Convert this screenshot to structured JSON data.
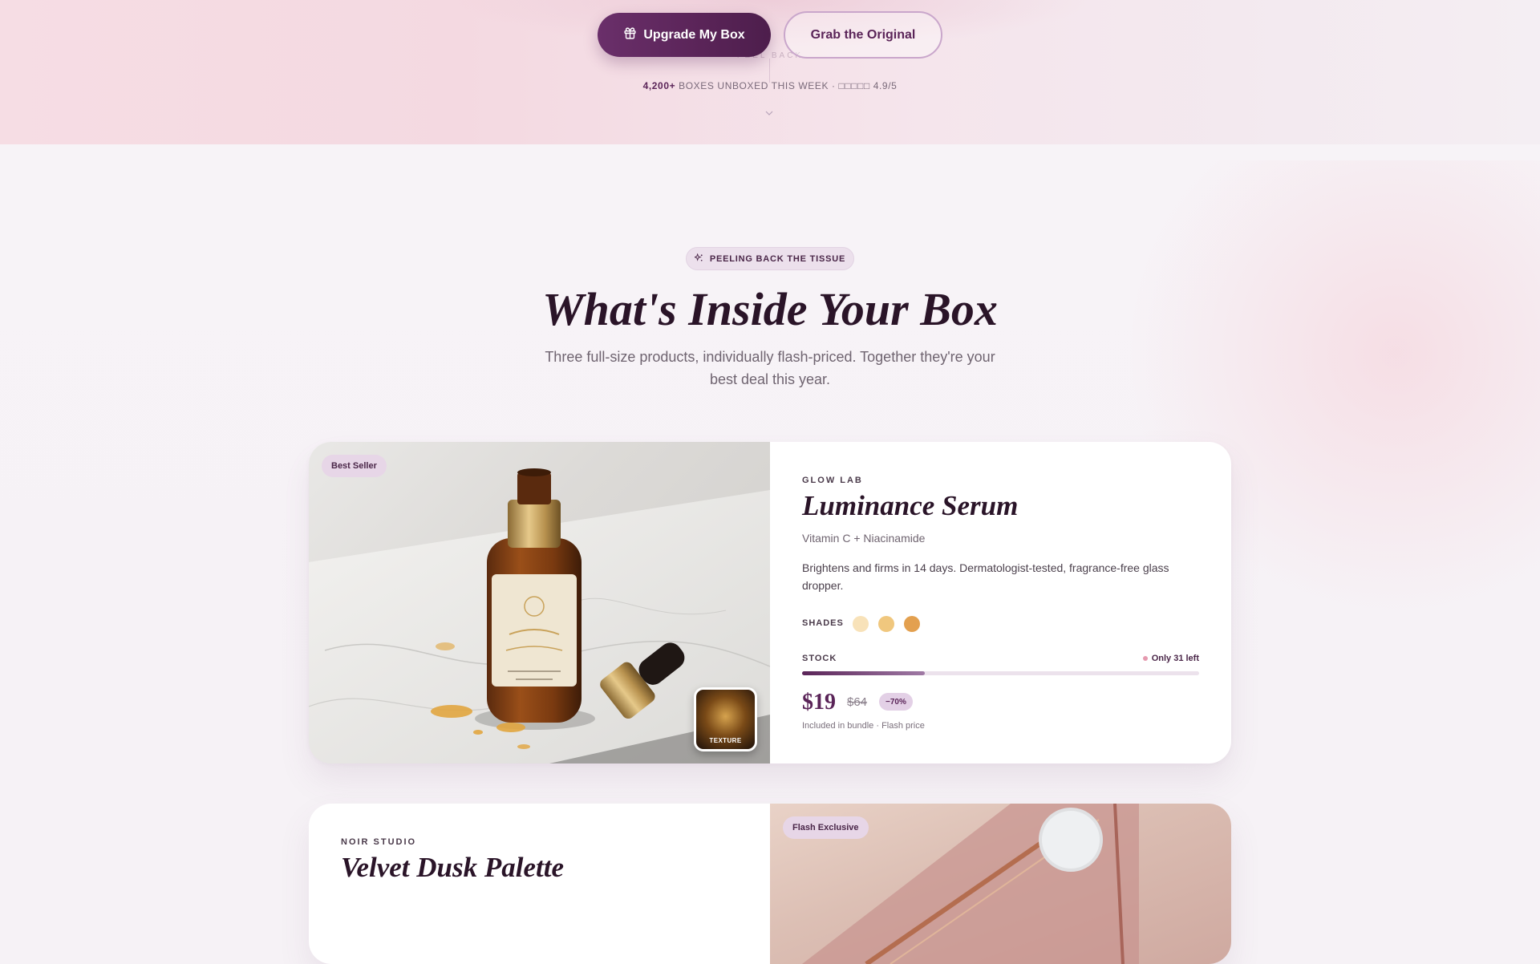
{
  "hero": {
    "primary_button_label": "Upgrade My Box",
    "secondary_button_label": "Grab the Original",
    "faded_label": "PEEL BACK",
    "proof_count": "4,200+",
    "proof_text": "BOXES UNBOXED THIS WEEK · □□□□□ 4.9/5"
  },
  "section": {
    "eyebrow": "PEELING BACK THE TISSUE",
    "title": "What's Inside Your Box",
    "subtitle": "Three full-size products, individually flash-priced. Together they're your best deal this year."
  },
  "products": [
    {
      "badge": "Best Seller",
      "texture_label": "TEXTURE",
      "brand": "GLOW LAB",
      "name": "Luminance Serum",
      "subtitle": "Vitamin C + Niacinamide",
      "description": "Brightens and firms in 14 days. Dermatologist-tested, fragrance-free glass dropper.",
      "shades_label": "SHADES",
      "shades": [
        "#f8e2b9",
        "#f0c77e",
        "#e3a04f"
      ],
      "stock_label": "STOCK",
      "stock_text": "Only 31 left",
      "stock_fraction": 0.31,
      "price": "$19",
      "old_price": "$64",
      "discount": "−70%",
      "price_note": "Included in bundle · Flash price"
    },
    {
      "badge": "Flash Exclusive",
      "brand": "NOIR STUDIO",
      "name": "Velvet Dusk Palette"
    }
  ],
  "colors": {
    "accent": "#5a2458",
    "pill_bg": "#ece0ec",
    "hero_pink": "#f6dde4"
  }
}
